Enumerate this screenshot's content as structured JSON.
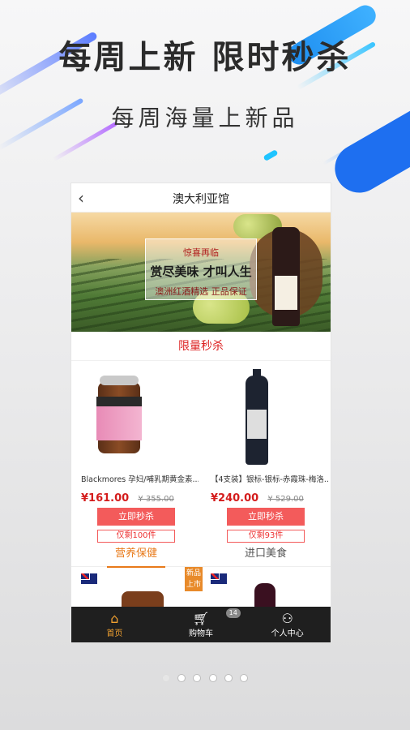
{
  "hero": {
    "headline": "每周上新  限时秒杀",
    "subline": "每周海量上新品"
  },
  "screen": {
    "nav": {
      "back_icon": "chevron-left-icon",
      "title": "澳大利亚馆"
    },
    "banner": {
      "line1": "惊喜再临",
      "line2": "赏尽美味 才叫人生",
      "line3": "澳洲红酒精选 正品保证"
    },
    "section_title": "限量秒杀",
    "products": [
      {
        "name": "Blackmores 孕妇/哺乳期黄金素...",
        "price": "¥161.00",
        "original_price": "¥ 355.00",
        "buy_label": "立即秒杀",
        "remaining": "仅剩100件"
      },
      {
        "name": "【4支装】银标-银标-赤霞珠-梅洛...",
        "price": "¥240.00",
        "original_price": "¥ 529.00",
        "buy_label": "立即秒杀",
        "remaining": "仅剩93件"
      }
    ],
    "tabs": [
      {
        "label": "营养保健",
        "active": true
      },
      {
        "label": "进口美食",
        "active": false
      }
    ],
    "new_tag": "新品上市",
    "tabbar": [
      {
        "icon": "home-icon",
        "label": "首页",
        "active": true
      },
      {
        "icon": "cart-icon",
        "label": "购物车",
        "badge": "14"
      },
      {
        "icon": "person-icon",
        "label": "个人中心"
      }
    ]
  },
  "pagination": {
    "count": 6,
    "active_index": 0
  },
  "colors": {
    "accent_red": "#f35b5b",
    "accent_orange": "#e87a1a",
    "tabbar_bg": "#1f1f1f"
  }
}
